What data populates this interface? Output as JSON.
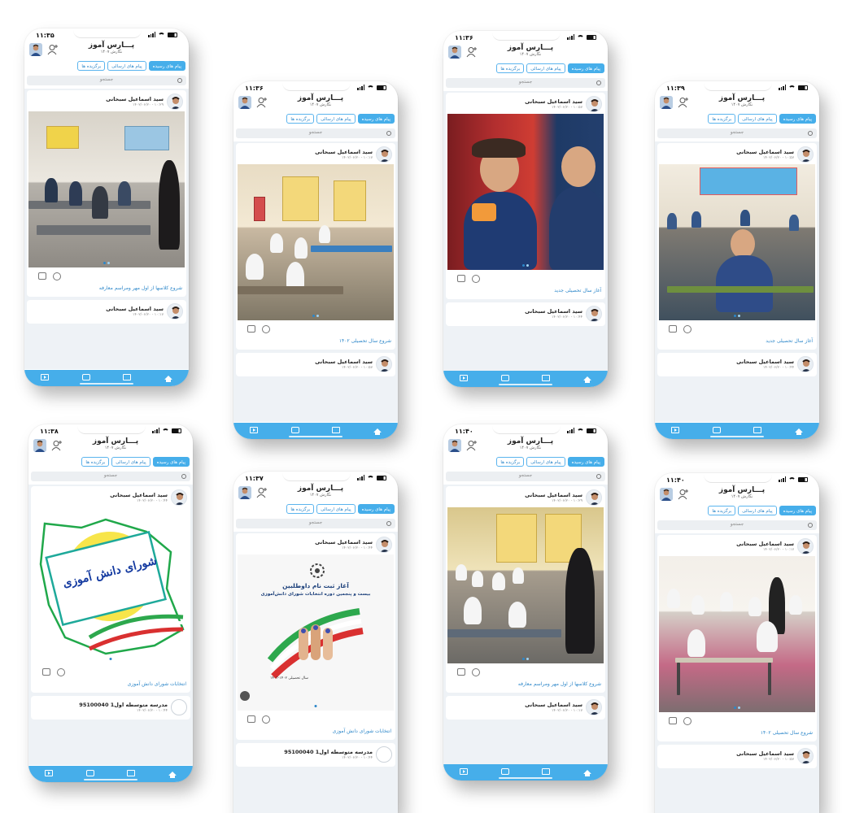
{
  "app": {
    "title": "پـــارس آموز",
    "subtitle": "نگارش ۱۴۰۷",
    "tabs": [
      "پیام های رسیده",
      "پیام های ارسالی",
      "برگزیده ها"
    ],
    "search_placeholder": "جستجو",
    "sender": "سید اسماعیل سبحانی",
    "brand_color": "#46aeea"
  },
  "phones": [
    {
      "time": "۱۱:۳۵",
      "card": {
        "date": "۱۴۰۲/۰۶/۲۰ - ۱۰:۲۹",
        "caption": "شروع کلاسها از اول مهر ومراسم معارفه"
      },
      "next": {
        "sender": "سید اسماعیل سبحانی",
        "date": "۱۴۰۲/۰۶/۲۰ - ۱۰:۱۷"
      }
    },
    {
      "time": "۱۱:۳۶",
      "card": {
        "date": "۱۴۰۲/۰۶/۲۰ - ۱۰:۱۷",
        "caption": "شروع سال تحصیلی ۱۴۰۲"
      },
      "next": {
        "sender": "سید اسماعیل سبحانی",
        "date": "۱۴۰۲/۰۶/۲۰ - ۱۰:۵۷"
      }
    },
    {
      "time": "۱۱:۳۶",
      "card": {
        "date": "۱۴۰۲/۰۶/۲۰ - ۱۰:۵۷",
        "caption": "آغاز سال تحصیلی جدید"
      },
      "next": {
        "sender": "سید اسماعیل سبحانی",
        "date": "۱۴۰۲/۰۶/۲۰ - ۱۰:۴۴"
      }
    },
    {
      "time": "۱۱:۳۹",
      "card": {
        "date": "۱۴۰۲/۰۶/۲۰ - ۱۰:۵۷",
        "caption": "آغاز سال تحصیلی جدید"
      },
      "next": {
        "sender": "سید اسماعیل سبحانی",
        "date": "۱۴۰۲/۰۶/۲۰ - ۱۰:۴۴"
      }
    },
    {
      "time": "۱۱:۳۸",
      "card": {
        "date": "۱۴۰۲/۰۶/۲۰ - ۱۰:۴۴",
        "caption": "انتخابات شورای دانش آموزی"
      },
      "next": {
        "sender": "95100040 مدرسه متوسطه اول1",
        "date": "۱۴۰۲/۰۶/۲۰ - ۱۰:۴۴"
      },
      "poster_text": "شورای دانش آموزی"
    },
    {
      "time": "۱۱:۳۷",
      "card": {
        "date": "۱۴۰۲/۰۶/۲۰ - ۱۰:۴۴",
        "caption": "انتخابات شورای دانش آموزی"
      },
      "next": {
        "sender": "95100040 مدرسه متوسطه اول1",
        "date": "۱۴۰۲/۰۶/۲۰ - ۱۰:۴۴"
      },
      "poster_line1": "آغاز ثبت نام داوطلبین",
      "poster_line2": "بیست و پنجمین دوره انتخابات شورای دانش‌آموزی",
      "poster_footer": "سال تحصیلی ۱۴۰۲-۱۴۰۳"
    },
    {
      "time": "۱۱:۴۰",
      "card": {
        "date": "۱۴۰۲/۰۶/۲۰ - ۱۰:۲۹",
        "caption": "شروع کلاسها از اول مهر ومراسم معارفه"
      },
      "next": {
        "sender": "سید اسماعیل سبحانی",
        "date": "۱۴۰۲/۰۶/۲۰ - ۱۰:۱۷"
      }
    },
    {
      "time": "۱۱:۴۰",
      "card": {
        "date": "۱۴۰۲/۰۶/۲۰ - ۱۰:۱۷",
        "caption": "شروع سال تحصیلی ۱۴۰۲"
      },
      "next": {
        "sender": "سید اسماعیل سبحانی",
        "date": "۱۴۰۲/۰۶/۲۰ - ۱۰:۵۷"
      }
    }
  ]
}
